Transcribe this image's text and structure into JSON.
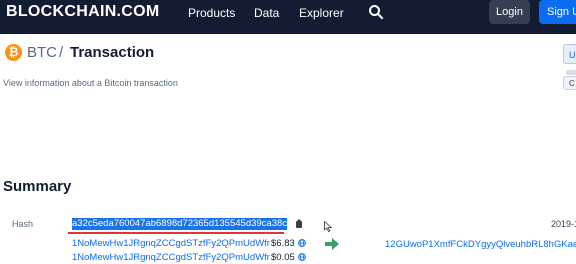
{
  "nav": {
    "logo": "BLOCKCHAIN.COM",
    "products": "Products",
    "data": "Data",
    "explorer": "Explorer",
    "login": "Login",
    "signup": "Sign U"
  },
  "header": {
    "coin_symbol": "₿",
    "coin": "BTC",
    "separator": "/",
    "title": "Transaction",
    "subtitle": "View information about a Bitcoin transaction",
    "side_tab_top": "U",
    "side_tab_bottom": "C"
  },
  "summary": {
    "title": "Summary",
    "hash_label": "Hash",
    "hash": "a32c5eda760047ab6898d72365d135545d39ca38c",
    "date": "2019-1",
    "inputs": [
      {
        "address": "1NoMewHw1JRgnqZCCgdSTzfFy2QPmUdWfr",
        "amount": "$6.83"
      },
      {
        "address": "1NoMewHw1JRgnqZCCgdSTzfFy2QPmUdWfr",
        "amount": "$0.05"
      }
    ],
    "output_address": "12GUwoP1XmfFCkDYgyyQlveuhbRL8hGKae"
  },
  "colors": {
    "nav_bg": "#121d33",
    "accent_blue": "#0c6cf2",
    "btc_orange": "#f7931a",
    "arrow_green": "#3d9b6a",
    "selection": "#1a73e8",
    "underline_red": "#e03535"
  },
  "icons": [
    "search-icon",
    "bitcoin-icon",
    "copy-icon",
    "globe-icon",
    "arrow-right-icon",
    "mouse-cursor-icon"
  ]
}
